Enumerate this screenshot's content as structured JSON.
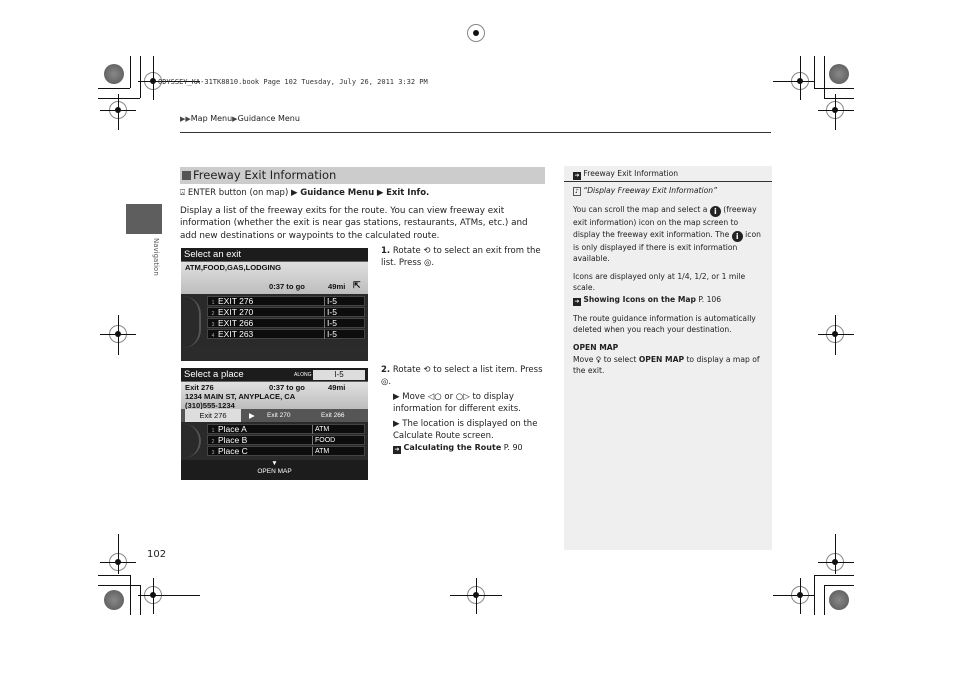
{
  "header_slug": "ODYSSEY_KA-31TK8810.book  Page 102  Tuesday, July 26, 2011  3:32 PM",
  "breadcrumb": {
    "items": [
      "Map Menu",
      "Guidance Menu"
    ]
  },
  "side_tab": "Navigation",
  "section": {
    "title": "Freeway Exit Information",
    "path": {
      "start": "ENTER button (on map)",
      "s1": "Guidance Menu",
      "s2": "Exit Info."
    },
    "description": "Display a list of the freeway exits for the route. You can view freeway exit information (whether the exit is near gas stations, restaurants, ATMs, etc.) and add new destinations or waypoints to the calculated route."
  },
  "screen1": {
    "title": "Select an exit",
    "categories": "ATM,FOOD,GAS,LODGING",
    "time": "0:37 to go",
    "distance": "49mi",
    "rows": [
      {
        "n": "1",
        "name": "EXIT 276",
        "road": "I-5"
      },
      {
        "n": "2",
        "name": "EXIT 270",
        "road": "I-5"
      },
      {
        "n": "3",
        "name": "EXIT 266",
        "road": "I-5"
      },
      {
        "n": "4",
        "name": "EXIT 263",
        "road": "I-5"
      }
    ]
  },
  "screen2": {
    "title": "Select a place",
    "along_label": "ALONG",
    "along_value": "I-5",
    "exit": "Exit 276",
    "time": "0:37 to go",
    "distance": "49mi",
    "address": "1234 MAIN ST, ANYPLACE, CA",
    "phone": "(310)555-1234",
    "tabs": [
      "Exit 276",
      "Exit 270",
      "Exit 266"
    ],
    "rows": [
      {
        "n": "1",
        "name": "Place A",
        "cat": "ATM"
      },
      {
        "n": "2",
        "name": "Place B",
        "cat": "FOOD"
      },
      {
        "n": "3",
        "name": "Place C",
        "cat": "ATM"
      }
    ],
    "open_map": "OPEN MAP"
  },
  "steps": {
    "s1_num": "1.",
    "s1_a": "Rotate",
    "s1_b": "to select an exit from the list. Press",
    "s2_num": "2.",
    "s2_a": "Rotate",
    "s2_b": "to select a list item. Press",
    "b1_a": "Move",
    "b1_or": "or",
    "b1_b": "to display information for different exits.",
    "b2": "The location is displayed on the Calculate Route screen.",
    "xref_label": "Calculating the Route",
    "xref_page": "P. 90"
  },
  "sidebar": {
    "title": "Freeway Exit Information",
    "voice": "“Display Freeway Exit Information”",
    "p1_a": "You can scroll the map and select a",
    "p1_b": "(freeway exit information) icon on the map screen to display the freeway exit information. The",
    "p1_c": "icon is only displayed if there is exit information available.",
    "p2": "Icons are displayed only at 1/4, 1/2, or 1 mile scale.",
    "xref_label": "Showing Icons on the Map",
    "xref_page": "P. 106",
    "p3": "The route guidance information is automatically deleted when you reach your destination.",
    "h_open": "OPEN MAP",
    "p4_a": "Move",
    "p4_b": "to select",
    "p4_bold": "OPEN MAP",
    "p4_c": "to display a map of the exit."
  },
  "page_number": "102"
}
